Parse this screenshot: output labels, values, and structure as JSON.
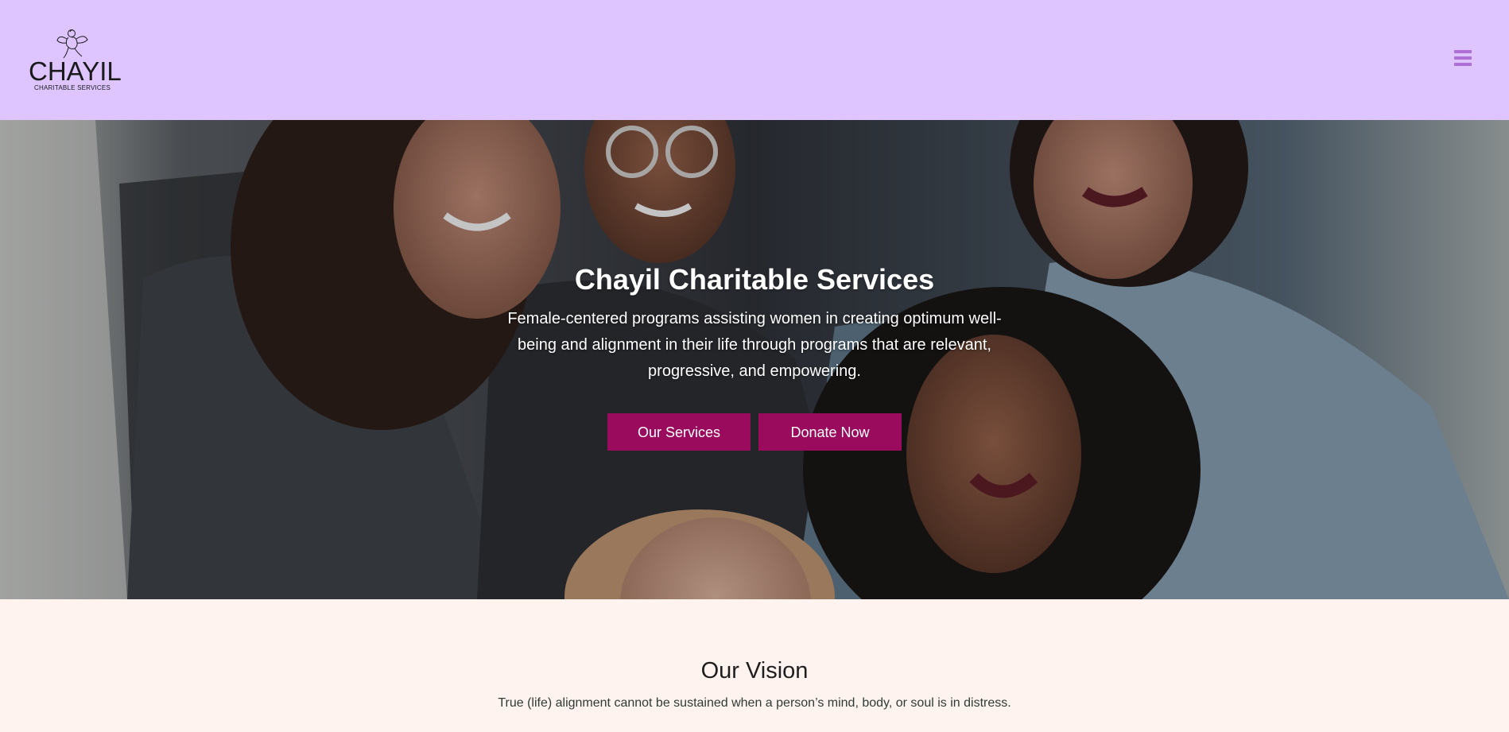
{
  "header": {
    "logo": {
      "name": "CHAYIL",
      "tagline": "CHARITABLE SERVICES",
      "icon": "angel-icon"
    },
    "menu_icon": "hamburger-menu-icon",
    "background_color": "#dfc5ff"
  },
  "hero": {
    "title": "Chayil Charitable Services",
    "description": "Female-centered programs assisting women in creating optimum well-being and alignment in their life through programs that are relevant, progressive, and empowering.",
    "buttons": {
      "services_label": "Our Services",
      "donate_label": "Donate Now"
    },
    "button_color": "#9a0b5e"
  },
  "vision": {
    "title": "Our Vision",
    "text": "True (life) alignment cannot be sustained when a person’s mind, body, or soul is in distress."
  },
  "colors": {
    "accent": "#9a0b5e",
    "header_bg": "#dfc5ff",
    "page_bg": "#fff3ef",
    "menu_icon": "#b06fd8"
  }
}
